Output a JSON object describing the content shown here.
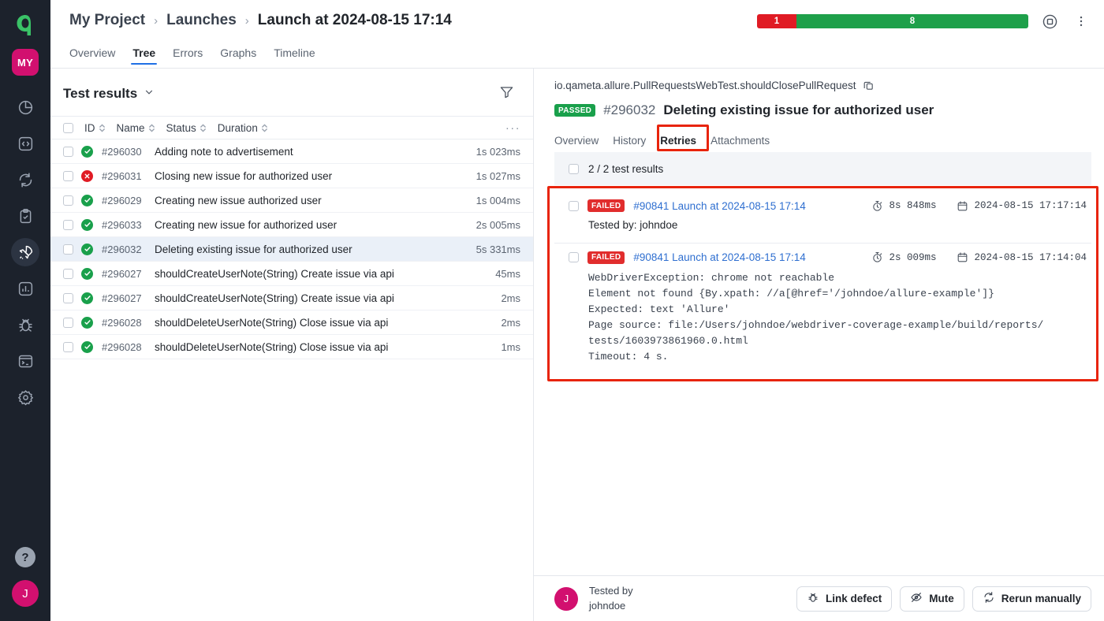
{
  "rail": {
    "logo_icon": "allure-logo-icon",
    "project_initials": "MY",
    "items": [
      {
        "name": "dashboard",
        "icon": "pie-chart-icon",
        "active": false
      },
      {
        "name": "code",
        "icon": "code-brackets-icon",
        "active": false
      },
      {
        "name": "sync",
        "icon": "sync-refresh-icon",
        "active": false
      },
      {
        "name": "testplan",
        "icon": "clipboard-check-icon",
        "active": false
      },
      {
        "name": "launches",
        "icon": "rocket-icon",
        "active": true
      },
      {
        "name": "analytics",
        "icon": "bar-chart-icon",
        "active": false
      },
      {
        "name": "defects",
        "icon": "bug-icon",
        "active": false
      },
      {
        "name": "console",
        "icon": "terminal-icon",
        "active": false
      },
      {
        "name": "settings",
        "icon": "gear-icon",
        "active": false
      }
    ],
    "help_label": "?",
    "user_initial": "J"
  },
  "header": {
    "breadcrumb": [
      "My Project",
      "Launches",
      "Launch at 2024-08-15 17:14"
    ],
    "separator": "›",
    "progress": {
      "failed_count": "1",
      "passed_count": "8",
      "failed_color": "#e01b24",
      "passed_color": "#1ea04a"
    },
    "stop_icon": "stop-square-icon",
    "more_icon": "more-vertical-icon",
    "tabs": [
      {
        "label": "Overview",
        "active": false
      },
      {
        "label": "Tree",
        "active": true
      },
      {
        "label": "Errors",
        "active": false
      },
      {
        "label": "Graphs",
        "active": false
      },
      {
        "label": "Timeline",
        "active": false
      }
    ]
  },
  "tree": {
    "title": "Test results",
    "chevron_icon": "chevron-down-icon",
    "filter_icon": "filter-funnel-icon",
    "more_icon": "more-horizontal-icon",
    "columns": [
      "ID",
      "Name",
      "Status",
      "Duration"
    ],
    "rows": [
      {
        "status": "passed",
        "id": "#296030",
        "name": "Adding note to advertisement",
        "duration": "1s 023ms",
        "selected": false
      },
      {
        "status": "failed",
        "id": "#296031",
        "name": "Closing new issue for authorized user",
        "duration": "1s 027ms",
        "selected": false
      },
      {
        "status": "passed",
        "id": "#296029",
        "name": "Creating new issue authorized user",
        "duration": "1s 004ms",
        "selected": false
      },
      {
        "status": "passed",
        "id": "#296033",
        "name": "Creating new issue for authorized user",
        "duration": "2s 005ms",
        "selected": false
      },
      {
        "status": "passed",
        "id": "#296032",
        "name": "Deleting existing issue for authorized user",
        "duration": "5s 331ms",
        "selected": true
      },
      {
        "status": "passed",
        "id": "#296027",
        "name": "shouldCreateUserNote(String) Create issue via api",
        "duration": "45ms",
        "selected": false
      },
      {
        "status": "passed",
        "id": "#296027",
        "name": "shouldCreateUserNote(String) Create issue via api",
        "duration": "2ms",
        "selected": false
      },
      {
        "status": "passed",
        "id": "#296028",
        "name": "shouldDeleteUserNote(String) Close issue via api",
        "duration": "2ms",
        "selected": false
      },
      {
        "status": "passed",
        "id": "#296028",
        "name": "shouldDeleteUserNote(String) Close issue via api",
        "duration": "1ms",
        "selected": false
      }
    ]
  },
  "detail": {
    "full_path": "io.qameta.allure.PullRequestsWebTest.shouldClosePullRequest",
    "copy_icon": "copy-icon",
    "status_badge": "PASSED",
    "test_number": "#296032",
    "test_name": "Deleting existing issue for authorized user",
    "tabs": [
      {
        "label": "Overview",
        "active": false
      },
      {
        "label": "History",
        "active": false
      },
      {
        "label": "Retries",
        "active": true
      },
      {
        "label": "Attachments",
        "active": false
      }
    ],
    "count_label": "2 / 2 test results",
    "retries": [
      {
        "status_badge": "FAILED",
        "link": "#90841 Launch at 2024-08-15 17:14",
        "duration_icon": "stopwatch-icon",
        "duration": "8s 848ms",
        "date_icon": "calendar-icon",
        "date": "2024-08-15 17:17:14",
        "body": "Tested by:\njohndoe",
        "body_mono": false
      },
      {
        "status_badge": "FAILED",
        "link": "#90841 Launch at 2024-08-15 17:14",
        "duration_icon": "stopwatch-icon",
        "duration": "2s 009ms",
        "date_icon": "calendar-icon",
        "date": "2024-08-15 17:14:04",
        "body": "WebDriverException: chrome not reachable\nElement not found {By.xpath: //a[@href='/johndoe/allure-example']}\nExpected: text 'Allure'\nPage source: file:/Users/johndoe/webdriver-coverage-example/build/reports/\ntests/1603973861960.0.html\nTimeout: 4 s.",
        "body_mono": true
      }
    ],
    "annotation_color": "#e8240c"
  },
  "footer": {
    "avatar_initial": "J",
    "tested_by_label": "Tested by",
    "tested_by_user": "johndoe",
    "buttons": [
      {
        "label": "Link defect",
        "icon": "bug-icon"
      },
      {
        "label": "Mute",
        "icon": "eye-off-icon"
      },
      {
        "label": "Rerun manually",
        "icon": "refresh-icon"
      }
    ]
  }
}
